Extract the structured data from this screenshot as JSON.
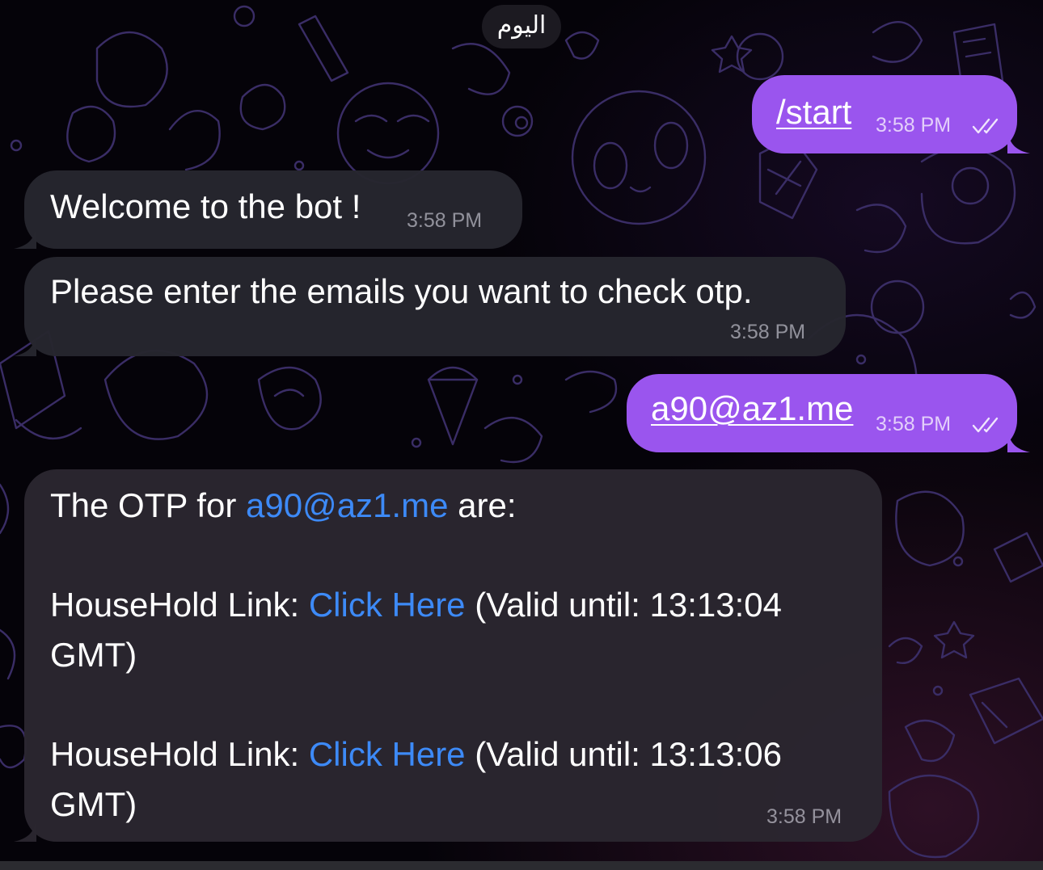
{
  "date_divider": "اليوم",
  "messages": [
    {
      "id": "m1",
      "direction": "outgoing",
      "text": "/start",
      "time": "3:58 PM",
      "status": "read-double-check"
    },
    {
      "id": "m2",
      "direction": "incoming",
      "text": "Welcome to the bot !",
      "time": "3:58 PM"
    },
    {
      "id": "m3",
      "direction": "incoming",
      "text": "Please enter the emails you want to check otp.",
      "time": "3:58 PM"
    },
    {
      "id": "m4",
      "direction": "outgoing",
      "text": "a90@az1.me",
      "time": "3:58 PM",
      "status": "read-double-check"
    },
    {
      "id": "m5",
      "direction": "incoming",
      "time": "3:58 PM",
      "intro_prefix": "The OTP for",
      "intro_email": "a90@az1.me",
      "intro_suffix": "are:",
      "links": [
        {
          "label": "HouseHold Link:",
          "link_text": "Click Here",
          "validity": "(Valid until: 13:13:04",
          "zone": "GMT)"
        },
        {
          "label": "HouseHold Link:",
          "link_text": "Click Here",
          "validity": "(Valid until: 13:13:06",
          "zone": "GMT)"
        }
      ]
    }
  ],
  "colors": {
    "outgoing_bubble": "#9a55ee",
    "incoming_bubble": "#26262e",
    "link": "#3d8af7",
    "background": "#050309",
    "pattern_line": "#3a2d66"
  },
  "icons": {
    "read_status": "double-check-icon",
    "background": "doodle-pattern"
  }
}
